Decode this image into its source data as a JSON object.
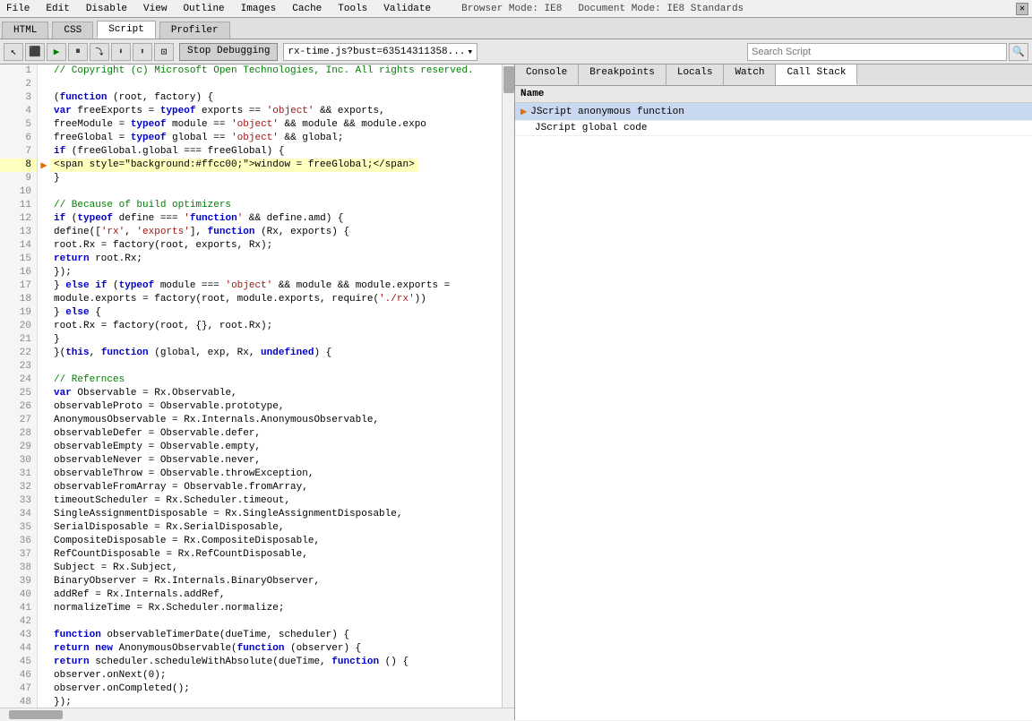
{
  "menubar": {
    "items": [
      "File",
      "Edit",
      "Disable",
      "View",
      "Outline",
      "Images",
      "Cache",
      "Tools",
      "Validate"
    ],
    "browser_mode": "Browser Mode: IE8",
    "doc_mode": "Document Mode: IE8 Standards"
  },
  "tabs": {
    "items": [
      "HTML",
      "CSS",
      "Script",
      "Profiler"
    ],
    "active": "Script"
  },
  "toolbar": {
    "file_label": "rx-time.js?bust=63514311358...",
    "stop_debugging": "Stop Debugging",
    "search_placeholder": "Search Script"
  },
  "right_tabs": [
    "Console",
    "Breakpoints",
    "Locals",
    "Watch",
    "Call Stack"
  ],
  "right_active_tab": "Call Stack",
  "call_stack": [
    {
      "label": "JScript anonymous function",
      "active": true
    },
    {
      "label": "JScript global code",
      "active": false
    }
  ],
  "name_header": "Name",
  "lines": [
    {
      "num": 1,
      "code": "// Copyright (c) Microsoft Open Technologies, Inc. All rights reserved.",
      "type": "comment"
    },
    {
      "num": 2,
      "code": ""
    },
    {
      "num": 3,
      "code": "(function (root, factory) {",
      "type": "code"
    },
    {
      "num": 4,
      "code": "    var freeExports = typeof exports == 'object' && exports,",
      "type": "code"
    },
    {
      "num": 5,
      "code": "        freeModule = typeof module == 'object' && module && module.expo",
      "type": "code"
    },
    {
      "num": 6,
      "code": "        freeGlobal = typeof global == 'object' && global;",
      "type": "code"
    },
    {
      "num": 7,
      "code": "    if (freeGlobal.global === freeGlobal) {",
      "type": "code"
    },
    {
      "num": 8,
      "code": "        window = freeGlobal;",
      "type": "current"
    },
    {
      "num": 9,
      "code": "    }",
      "type": "code"
    },
    {
      "num": 10,
      "code": ""
    },
    {
      "num": 11,
      "code": "    // Because of build optimizers",
      "type": "comment"
    },
    {
      "num": 12,
      "code": "    if (typeof define === 'function' && define.amd) {",
      "type": "code"
    },
    {
      "num": 13,
      "code": "        define(['rx', 'exports'], function (Rx, exports) {",
      "type": "code"
    },
    {
      "num": 14,
      "code": "            root.Rx = factory(root, exports, Rx);",
      "type": "code"
    },
    {
      "num": 15,
      "code": "            return root.Rx;",
      "type": "code"
    },
    {
      "num": 16,
      "code": "        });",
      "type": "code"
    },
    {
      "num": 17,
      "code": "    } else if (typeof module === 'object' && module && module.exports =",
      "type": "code"
    },
    {
      "num": 18,
      "code": "        module.exports = factory(root, module.exports, require('./rx'))",
      "type": "code"
    },
    {
      "num": 19,
      "code": "    } else {",
      "type": "code"
    },
    {
      "num": 20,
      "code": "        root.Rx = factory(root, {}, root.Rx);",
      "type": "code"
    },
    {
      "num": 21,
      "code": "    }",
      "type": "code"
    },
    {
      "num": 22,
      "code": "}(this, function (global, exp, Rx, undefined) {",
      "type": "code"
    },
    {
      "num": 23,
      "code": ""
    },
    {
      "num": 24,
      "code": "    // Refernces",
      "type": "comment"
    },
    {
      "num": 25,
      "code": "    var Observable = Rx.Observable,",
      "type": "code"
    },
    {
      "num": 26,
      "code": "        observableProto = Observable.prototype,",
      "type": "code"
    },
    {
      "num": 27,
      "code": "        AnonymousObservable = Rx.Internals.AnonymousObservable,",
      "type": "code"
    },
    {
      "num": 28,
      "code": "        observableDefer = Observable.defer,",
      "type": "code"
    },
    {
      "num": 29,
      "code": "        observableEmpty = Observable.empty,",
      "type": "code"
    },
    {
      "num": 30,
      "code": "        observableNever = Observable.never,",
      "type": "code"
    },
    {
      "num": 31,
      "code": "        observableThrow = Observable.throwException,",
      "type": "code"
    },
    {
      "num": 32,
      "code": "        observableFromArray = Observable.fromArray,",
      "type": "code"
    },
    {
      "num": 33,
      "code": "        timeoutScheduler = Rx.Scheduler.timeout,",
      "type": "code"
    },
    {
      "num": 34,
      "code": "        SingleAssignmentDisposable = Rx.SingleAssignmentDisposable,",
      "type": "code"
    },
    {
      "num": 35,
      "code": "        SerialDisposable = Rx.SerialDisposable,",
      "type": "code"
    },
    {
      "num": 36,
      "code": "        CompositeDisposable = Rx.CompositeDisposable,",
      "type": "code"
    },
    {
      "num": 37,
      "code": "        RefCountDisposable = Rx.RefCountDisposable,",
      "type": "code"
    },
    {
      "num": 38,
      "code": "        Subject = Rx.Subject,",
      "type": "code"
    },
    {
      "num": 39,
      "code": "        BinaryObserver = Rx.Internals.BinaryObserver,",
      "type": "code"
    },
    {
      "num": 40,
      "code": "        addRef = Rx.Internals.addRef,",
      "type": "code"
    },
    {
      "num": 41,
      "code": "        normalizeTime = Rx.Scheduler.normalize;",
      "type": "code"
    },
    {
      "num": 42,
      "code": ""
    },
    {
      "num": 43,
      "code": "    function observableTimerDate(dueTime, scheduler) {",
      "type": "code"
    },
    {
      "num": 44,
      "code": "        return new AnonymousObservable(function (observer) {",
      "type": "code"
    },
    {
      "num": 45,
      "code": "            return scheduler.scheduleWithAbsolute(dueTime, function () {",
      "type": "code"
    },
    {
      "num": 46,
      "code": "                observer.onNext(0);",
      "type": "code"
    },
    {
      "num": 47,
      "code": "                observer.onCompleted();",
      "type": "code"
    },
    {
      "num": 48,
      "code": "            });"
    }
  ]
}
